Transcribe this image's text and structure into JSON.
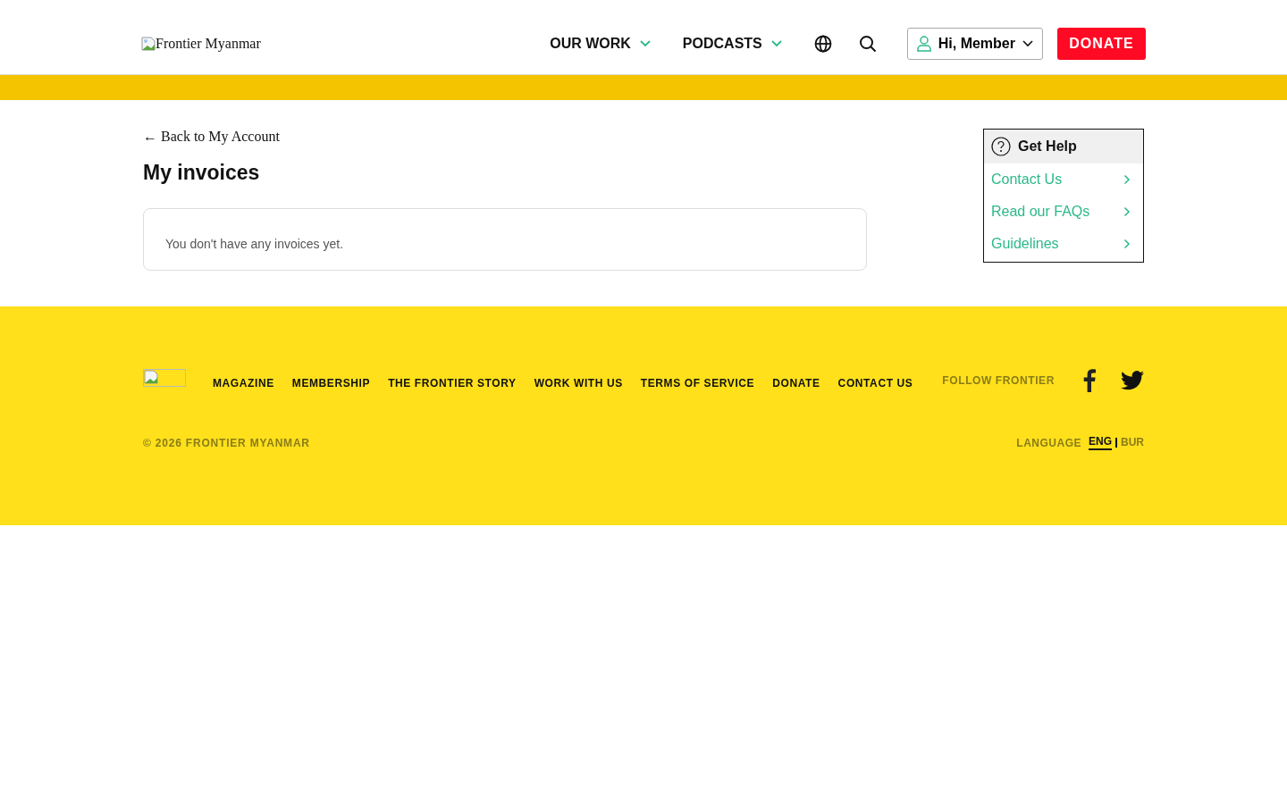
{
  "header": {
    "logo_alt": "Frontier Myanmar",
    "nav": [
      {
        "label": "OUR WORK"
      },
      {
        "label": "PODCASTS"
      }
    ],
    "account_button": "Hi, Member",
    "donate_button": "DONATE"
  },
  "main": {
    "back_link": "← Back to My Account",
    "title": "My invoices",
    "empty_message": "You don't have any invoices yet."
  },
  "help": {
    "title": "Get Help",
    "links": [
      "Contact Us",
      "Read our FAQs",
      "Guidelines"
    ]
  },
  "footer": {
    "links": [
      "MAGAZINE",
      "MEMBERSHIP",
      "THE FRONTIER STORY",
      "WORK WITH US",
      "TERMS OF SERVICE",
      "DONATE",
      "CONTACT US"
    ],
    "follow_label": "FOLLOW FRONTIER",
    "copyright": "© 2026 FRONTIER MYANMAR",
    "language_label": "LANGUAGE",
    "languages": [
      {
        "label": "ENG",
        "selected": true
      },
      {
        "label": "BUR",
        "selected": false
      }
    ]
  }
}
